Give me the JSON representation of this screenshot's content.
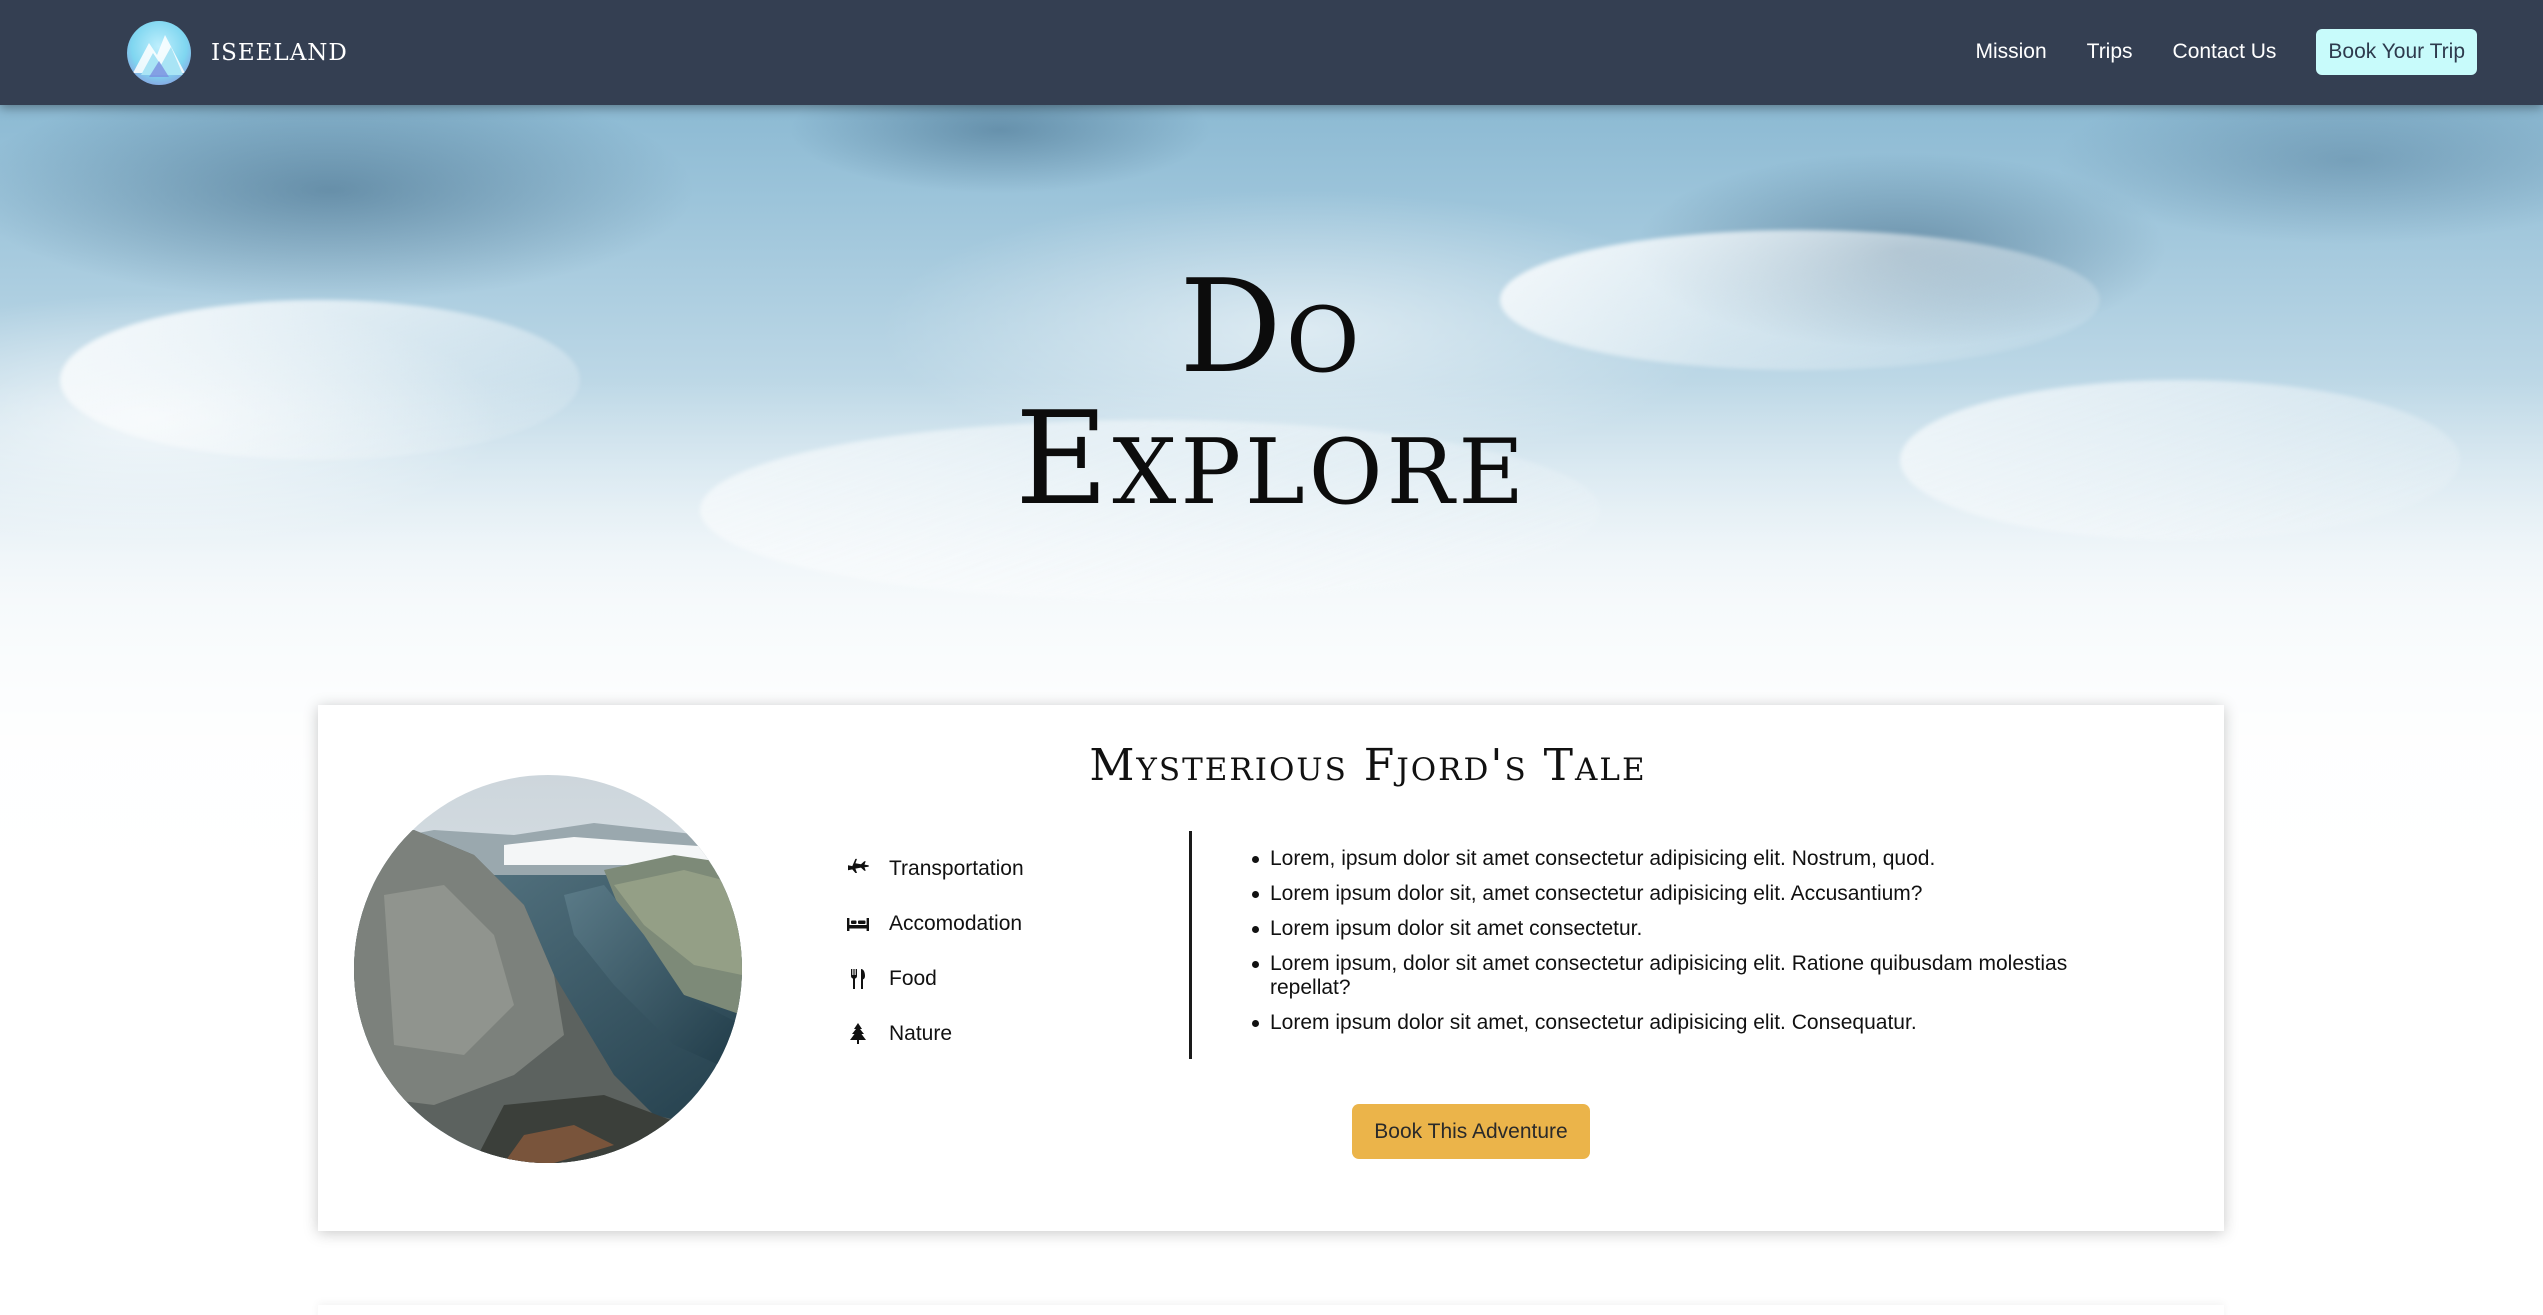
{
  "navbar": {
    "brand_name": "ISEELAND",
    "links": [
      "Mission",
      "Trips",
      "Contact Us"
    ],
    "cta_label": "Book Your Trip",
    "background_color": "#343f52",
    "cta_color": "#c8fbfb"
  },
  "hero": {
    "line1": "Do",
    "line2": "Explore"
  },
  "card": {
    "title": "Mysterious Fjord's Tale",
    "amenities": [
      {
        "icon": "airplane-icon",
        "label": "Transportation"
      },
      {
        "icon": "bed-icon",
        "label": "Accomodation"
      },
      {
        "icon": "fork-knife-icon",
        "label": "Food"
      },
      {
        "icon": "tree-icon",
        "label": "Nature"
      }
    ],
    "features": [
      "Lorem, ipsum dolor sit amet consectetur adipisicing elit. Nostrum, quod.",
      "Lorem ipsum dolor sit, amet consectetur adipisicing elit. Accusantium?",
      "Lorem ipsum dolor sit amet consectetur.",
      "Lorem ipsum, dolor sit amet consectetur adipisicing elit. Ratione quibusdam molestias repellat?",
      "Lorem ipsum dolor sit amet, consectetur adipisicing elit. Consequatur."
    ],
    "button_label": "Book This Adventure",
    "button_color": "#ebb44a"
  }
}
